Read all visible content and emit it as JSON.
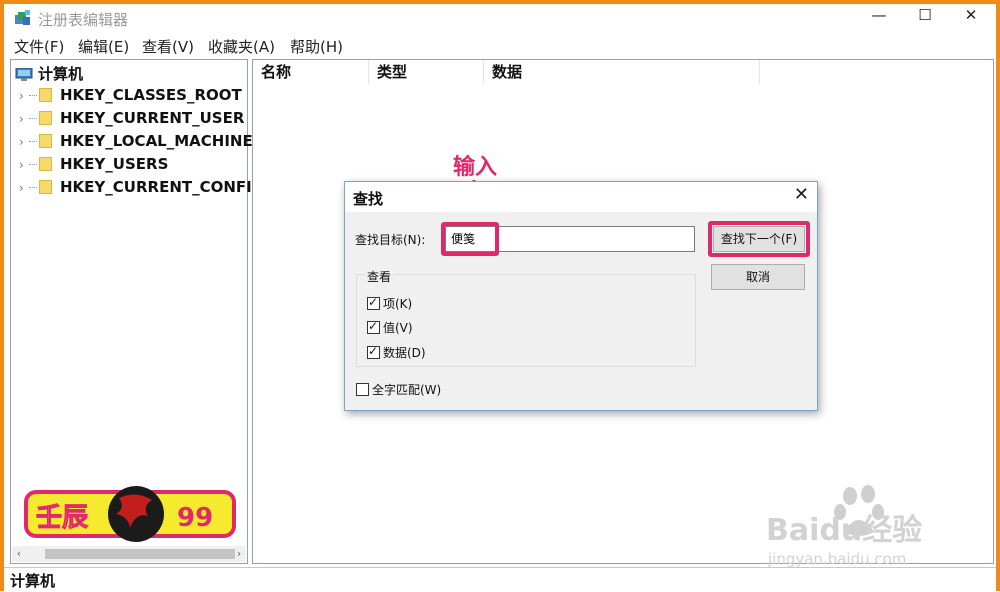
{
  "window": {
    "title": "注册表编辑器",
    "minimize_glyph": "—",
    "maximize_glyph": "☐",
    "close_glyph": "✕"
  },
  "menu": [
    "文件(F)",
    "编辑(E)",
    "查看(V)",
    "收藏夹(A)",
    "帮助(H)"
  ],
  "tree": {
    "root": "计算机",
    "items": [
      "HKEY_CLASSES_ROOT",
      "HKEY_CURRENT_USER",
      "HKEY_LOCAL_MACHINE",
      "HKEY_USERS",
      "HKEY_CURRENT_CONFIG"
    ]
  },
  "list": {
    "columns": [
      "名称",
      "类型",
      "数据"
    ]
  },
  "status": "计算机",
  "logo": {
    "left_text": "壬辰",
    "right_text": "99"
  },
  "watermark": {
    "brand": "Baidu经验",
    "url": "jingyan.baidu.com"
  },
  "dialog": {
    "title": "查找",
    "close_glyph": "✕",
    "find_label": "查找目标(N):",
    "find_value": "便笺",
    "find_next": "查找下一个(F)",
    "cancel": "取消",
    "group_label": "查看",
    "checks": [
      {
        "label": "项(K)",
        "checked": true
      },
      {
        "label": "值(V)",
        "checked": true
      },
      {
        "label": "数据(D)",
        "checked": true
      }
    ],
    "whole_word": {
      "label": "全字匹配(W)",
      "checked": false
    }
  },
  "annotation": {
    "text": "输入",
    "color": "#e0286c"
  },
  "colors": {
    "frame": "#f28a18",
    "highlight": "#e0286c"
  }
}
